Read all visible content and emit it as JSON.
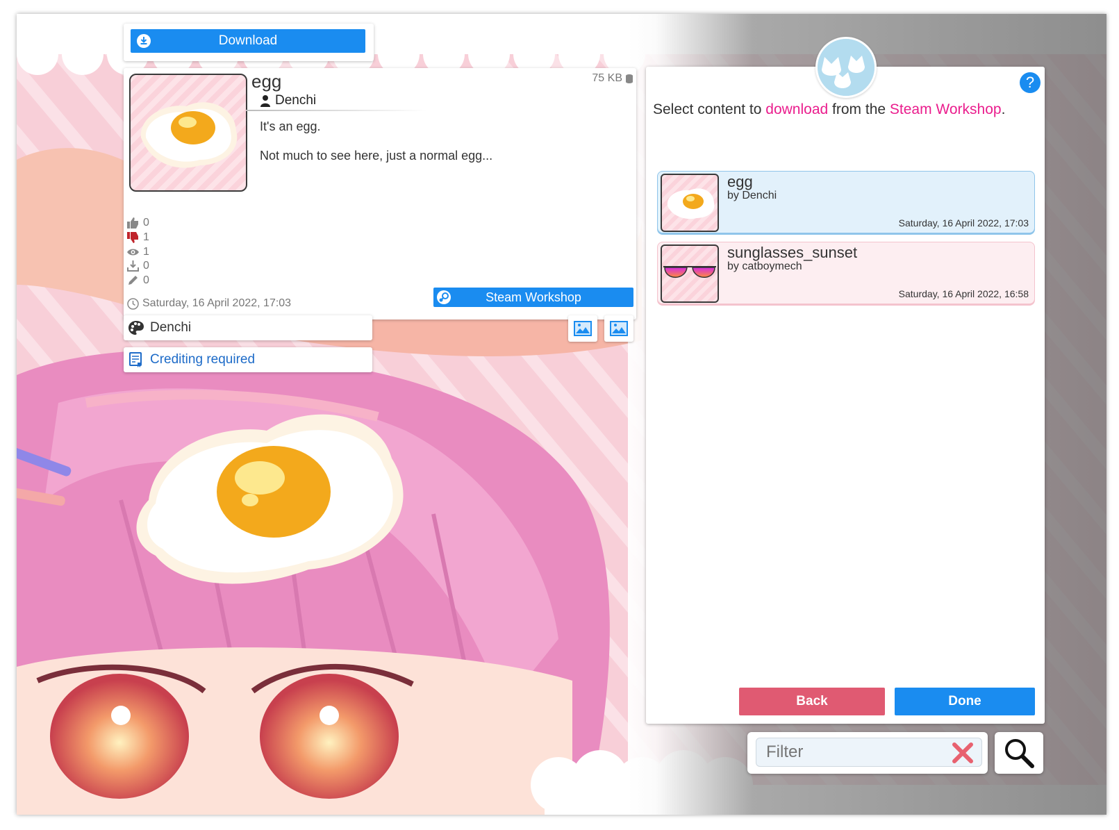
{
  "download": {
    "label": "Download"
  },
  "item": {
    "title": "egg",
    "author": "Denchi",
    "size": "75 KB",
    "description_lines": [
      "It's an egg.",
      "Not much to see here, just a normal egg..."
    ],
    "stats": {
      "likes": "0",
      "dislikes": "1",
      "views": "1",
      "downloads": "0",
      "edits": "0"
    },
    "date": "Saturday, 16 April 2022, 17:03",
    "steam_button": "Steam Workshop"
  },
  "creator": {
    "name": "Denchi",
    "license": "Crediting required"
  },
  "panel": {
    "prompt_prefix": "Select content to ",
    "prompt_download": "download",
    "prompt_middle": " from the ",
    "prompt_steam": "Steam Workshop",
    "prompt_suffix": ".",
    "help": "?",
    "items": [
      {
        "name": "egg",
        "by": "by Denchi",
        "date": "Saturday, 16 April 2022, 17:03"
      },
      {
        "name": "sunglasses_sunset",
        "by": "by catboymech",
        "date": "Saturday, 16 April 2022, 16:58"
      }
    ],
    "back": "Back",
    "done": "Done"
  },
  "filter": {
    "placeholder": "Filter"
  },
  "colors": {
    "accent_blue": "#1a8cf0",
    "accent_pink": "#ea1d8d",
    "back_red": "#e05a72",
    "selected_bg": "#e2f1fb"
  }
}
